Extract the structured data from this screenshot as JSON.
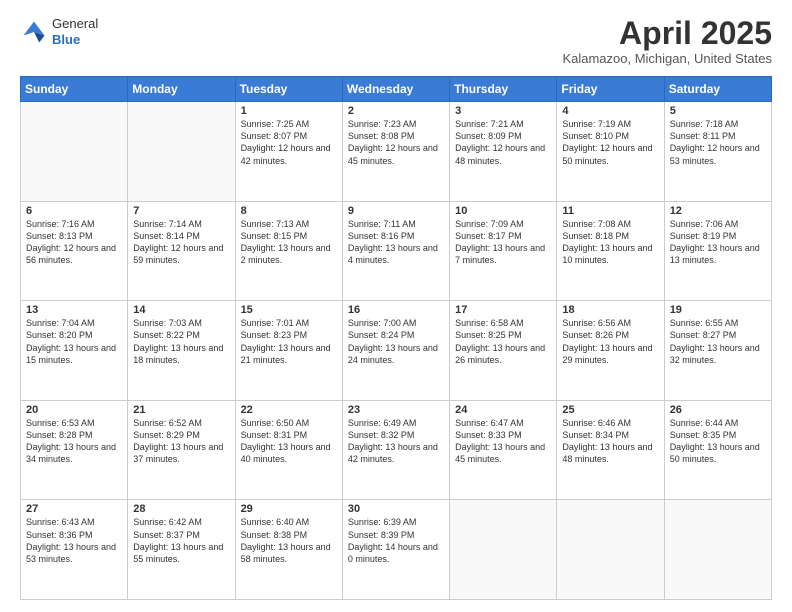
{
  "logo": {
    "general": "General",
    "blue": "Blue"
  },
  "title": "April 2025",
  "subtitle": "Kalamazoo, Michigan, United States",
  "days_of_week": [
    "Sunday",
    "Monday",
    "Tuesday",
    "Wednesday",
    "Thursday",
    "Friday",
    "Saturday"
  ],
  "weeks": [
    [
      {
        "day": "",
        "info": ""
      },
      {
        "day": "",
        "info": ""
      },
      {
        "day": "1",
        "info": "Sunrise: 7:25 AM\nSunset: 8:07 PM\nDaylight: 12 hours and 42 minutes."
      },
      {
        "day": "2",
        "info": "Sunrise: 7:23 AM\nSunset: 8:08 PM\nDaylight: 12 hours and 45 minutes."
      },
      {
        "day": "3",
        "info": "Sunrise: 7:21 AM\nSunset: 8:09 PM\nDaylight: 12 hours and 48 minutes."
      },
      {
        "day": "4",
        "info": "Sunrise: 7:19 AM\nSunset: 8:10 PM\nDaylight: 12 hours and 50 minutes."
      },
      {
        "day": "5",
        "info": "Sunrise: 7:18 AM\nSunset: 8:11 PM\nDaylight: 12 hours and 53 minutes."
      }
    ],
    [
      {
        "day": "6",
        "info": "Sunrise: 7:16 AM\nSunset: 8:13 PM\nDaylight: 12 hours and 56 minutes."
      },
      {
        "day": "7",
        "info": "Sunrise: 7:14 AM\nSunset: 8:14 PM\nDaylight: 12 hours and 59 minutes."
      },
      {
        "day": "8",
        "info": "Sunrise: 7:13 AM\nSunset: 8:15 PM\nDaylight: 13 hours and 2 minutes."
      },
      {
        "day": "9",
        "info": "Sunrise: 7:11 AM\nSunset: 8:16 PM\nDaylight: 13 hours and 4 minutes."
      },
      {
        "day": "10",
        "info": "Sunrise: 7:09 AM\nSunset: 8:17 PM\nDaylight: 13 hours and 7 minutes."
      },
      {
        "day": "11",
        "info": "Sunrise: 7:08 AM\nSunset: 8:18 PM\nDaylight: 13 hours and 10 minutes."
      },
      {
        "day": "12",
        "info": "Sunrise: 7:06 AM\nSunset: 8:19 PM\nDaylight: 13 hours and 13 minutes."
      }
    ],
    [
      {
        "day": "13",
        "info": "Sunrise: 7:04 AM\nSunset: 8:20 PM\nDaylight: 13 hours and 15 minutes."
      },
      {
        "day": "14",
        "info": "Sunrise: 7:03 AM\nSunset: 8:22 PM\nDaylight: 13 hours and 18 minutes."
      },
      {
        "day": "15",
        "info": "Sunrise: 7:01 AM\nSunset: 8:23 PM\nDaylight: 13 hours and 21 minutes."
      },
      {
        "day": "16",
        "info": "Sunrise: 7:00 AM\nSunset: 8:24 PM\nDaylight: 13 hours and 24 minutes."
      },
      {
        "day": "17",
        "info": "Sunrise: 6:58 AM\nSunset: 8:25 PM\nDaylight: 13 hours and 26 minutes."
      },
      {
        "day": "18",
        "info": "Sunrise: 6:56 AM\nSunset: 8:26 PM\nDaylight: 13 hours and 29 minutes."
      },
      {
        "day": "19",
        "info": "Sunrise: 6:55 AM\nSunset: 8:27 PM\nDaylight: 13 hours and 32 minutes."
      }
    ],
    [
      {
        "day": "20",
        "info": "Sunrise: 6:53 AM\nSunset: 8:28 PM\nDaylight: 13 hours and 34 minutes."
      },
      {
        "day": "21",
        "info": "Sunrise: 6:52 AM\nSunset: 8:29 PM\nDaylight: 13 hours and 37 minutes."
      },
      {
        "day": "22",
        "info": "Sunrise: 6:50 AM\nSunset: 8:31 PM\nDaylight: 13 hours and 40 minutes."
      },
      {
        "day": "23",
        "info": "Sunrise: 6:49 AM\nSunset: 8:32 PM\nDaylight: 13 hours and 42 minutes."
      },
      {
        "day": "24",
        "info": "Sunrise: 6:47 AM\nSunset: 8:33 PM\nDaylight: 13 hours and 45 minutes."
      },
      {
        "day": "25",
        "info": "Sunrise: 6:46 AM\nSunset: 8:34 PM\nDaylight: 13 hours and 48 minutes."
      },
      {
        "day": "26",
        "info": "Sunrise: 6:44 AM\nSunset: 8:35 PM\nDaylight: 13 hours and 50 minutes."
      }
    ],
    [
      {
        "day": "27",
        "info": "Sunrise: 6:43 AM\nSunset: 8:36 PM\nDaylight: 13 hours and 53 minutes."
      },
      {
        "day": "28",
        "info": "Sunrise: 6:42 AM\nSunset: 8:37 PM\nDaylight: 13 hours and 55 minutes."
      },
      {
        "day": "29",
        "info": "Sunrise: 6:40 AM\nSunset: 8:38 PM\nDaylight: 13 hours and 58 minutes."
      },
      {
        "day": "30",
        "info": "Sunrise: 6:39 AM\nSunset: 8:39 PM\nDaylight: 14 hours and 0 minutes."
      },
      {
        "day": "",
        "info": ""
      },
      {
        "day": "",
        "info": ""
      },
      {
        "day": "",
        "info": ""
      }
    ]
  ]
}
